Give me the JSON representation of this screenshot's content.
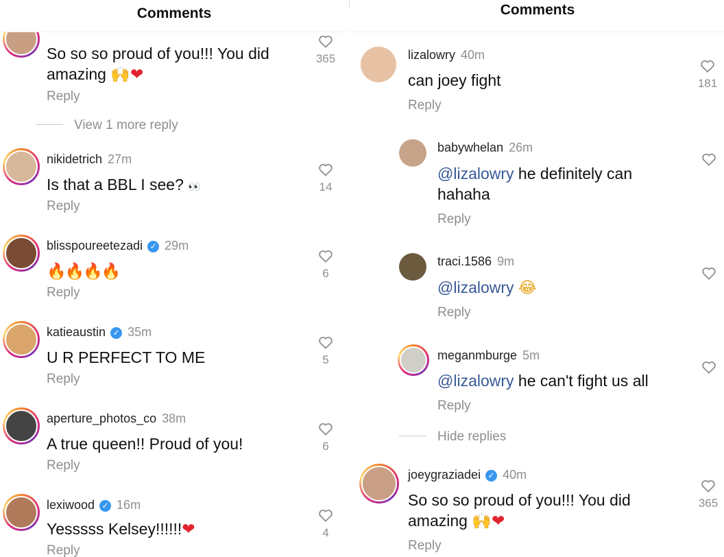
{
  "left": {
    "title": "Comments",
    "top_comment": {
      "text": "So so so proud of you!!! You did amazing",
      "emoji": "🙌❤",
      "reply": "Reply",
      "likes": "365"
    },
    "view_more": "View 1 more reply",
    "comments": [
      {
        "user": "nikidetrich",
        "verified": false,
        "time": "27m",
        "text": "Is that a BBL I see?",
        "emoji": "👀",
        "reply": "Reply",
        "likes": "14"
      },
      {
        "user": "blisspoureetezadi",
        "verified": true,
        "time": "29m",
        "text": "",
        "emoji": "🔥🔥🔥🔥",
        "reply": "Reply",
        "likes": "6"
      },
      {
        "user": "katieaustin",
        "verified": true,
        "time": "35m",
        "text": "U R PERFECT TO ME",
        "emoji": "",
        "reply": "Reply",
        "likes": "5"
      },
      {
        "user": "aperture_photos_co",
        "verified": false,
        "time": "38m",
        "text": "A true queen!! Proud of you!",
        "emoji": "",
        "reply": "Reply",
        "likes": "6"
      },
      {
        "user": "lexiwood",
        "verified": true,
        "time": "16m",
        "text": "Yesssss Kelsey!!!!!!",
        "emoji": "❤",
        "reply": "Reply",
        "likes": "4"
      }
    ]
  },
  "right": {
    "title": "Comments",
    "main": {
      "user": "lizalowry",
      "time": "40m",
      "text": "can joey fight",
      "reply": "Reply",
      "likes": "181"
    },
    "replies": [
      {
        "user": "babywhelan",
        "time": "26m",
        "mention": "@lizalowry",
        "text": " he definitely can",
        "text2": "hahaha",
        "emoji": "",
        "reply": "Reply"
      },
      {
        "user": "traci.1586",
        "time": "9m",
        "mention": "@lizalowry",
        "text": " ",
        "text2": "",
        "emoji": "😂",
        "reply": "Reply"
      },
      {
        "user": "meganmburge",
        "time": "5m",
        "mention": "@lizalowry",
        "text": " he can't fight us all",
        "text2": "",
        "emoji": "",
        "reply": "Reply"
      }
    ],
    "hide_replies": "Hide replies",
    "bottom": {
      "user": "joeygraziadei",
      "verified": true,
      "time": "40m",
      "text": "So so so proud of you!!! You did",
      "text2": "amazing",
      "emoji": "🙌❤",
      "reply": "Reply",
      "likes": "365"
    }
  }
}
